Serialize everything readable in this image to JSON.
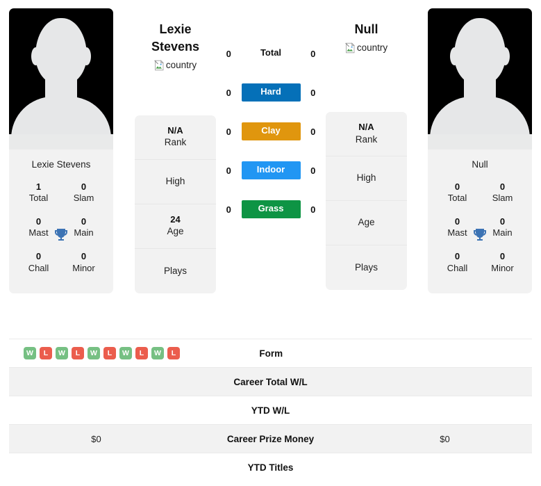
{
  "players": {
    "left": {
      "head_name": "Lexie Stevens",
      "flag_alt": "country",
      "photo_name": "Lexie Stevens",
      "titles": [
        {
          "num": "1",
          "label": "Total"
        },
        {
          "num": "0",
          "label": "Slam"
        },
        {
          "num": "0",
          "label": "Mast"
        },
        {
          "num": "0",
          "label": "Main"
        },
        {
          "num": "0",
          "label": "Chall"
        },
        {
          "num": "0",
          "label": "Minor"
        }
      ],
      "info": [
        {
          "value": "N/A",
          "label": "Rank"
        },
        {
          "value": "",
          "label": "High"
        },
        {
          "value": "24",
          "label": "Age"
        },
        {
          "value": "",
          "label": "Plays"
        }
      ]
    },
    "right": {
      "head_name": "Null",
      "flag_alt": "country",
      "photo_name": "Null",
      "titles": [
        {
          "num": "0",
          "label": "Total"
        },
        {
          "num": "0",
          "label": "Slam"
        },
        {
          "num": "0",
          "label": "Mast"
        },
        {
          "num": "0",
          "label": "Main"
        },
        {
          "num": "0",
          "label": "Chall"
        },
        {
          "num": "0",
          "label": "Minor"
        }
      ],
      "info": [
        {
          "value": "N/A",
          "label": "Rank"
        },
        {
          "value": "",
          "label": "High"
        },
        {
          "value": "",
          "label": "Age"
        },
        {
          "value": "",
          "label": "Plays"
        }
      ]
    }
  },
  "surfaces": [
    {
      "label": "Total",
      "left": "0",
      "right": "0",
      "color": "",
      "plain": true
    },
    {
      "label": "Hard",
      "left": "0",
      "right": "0",
      "color": "#0570b8",
      "plain": false
    },
    {
      "label": "Clay",
      "left": "0",
      "right": "0",
      "color": "#e0960e",
      "plain": false
    },
    {
      "label": "Indoor",
      "left": "0",
      "right": "0",
      "color": "#2196f3",
      "plain": false
    },
    {
      "label": "Grass",
      "left": "0",
      "right": "0",
      "color": "#0e9444",
      "plain": false
    }
  ],
  "table": {
    "rows": [
      {
        "label": "Form",
        "left": "",
        "right": "",
        "striped": false,
        "form": [
          "W",
          "L",
          "W",
          "L",
          "W",
          "L",
          "W",
          "L",
          "W",
          "L"
        ]
      },
      {
        "label": "Career Total W/L",
        "left": "",
        "right": "",
        "striped": true,
        "form": []
      },
      {
        "label": "YTD W/L",
        "left": "",
        "right": "",
        "striped": false,
        "form": []
      },
      {
        "label": "Career Prize Money",
        "left": "$0",
        "right": "$0",
        "striped": true,
        "form": []
      },
      {
        "label": "YTD Titles",
        "left": "",
        "right": "",
        "striped": false,
        "form": []
      }
    ]
  },
  "colors": {
    "win": "#76c083",
    "loss": "#eb5d4d",
    "trophy": "#3c73b4",
    "card_bg": "#f2f2f2"
  },
  "icons": {
    "trophy": "trophy-icon",
    "broken_image": "broken-image-icon"
  }
}
